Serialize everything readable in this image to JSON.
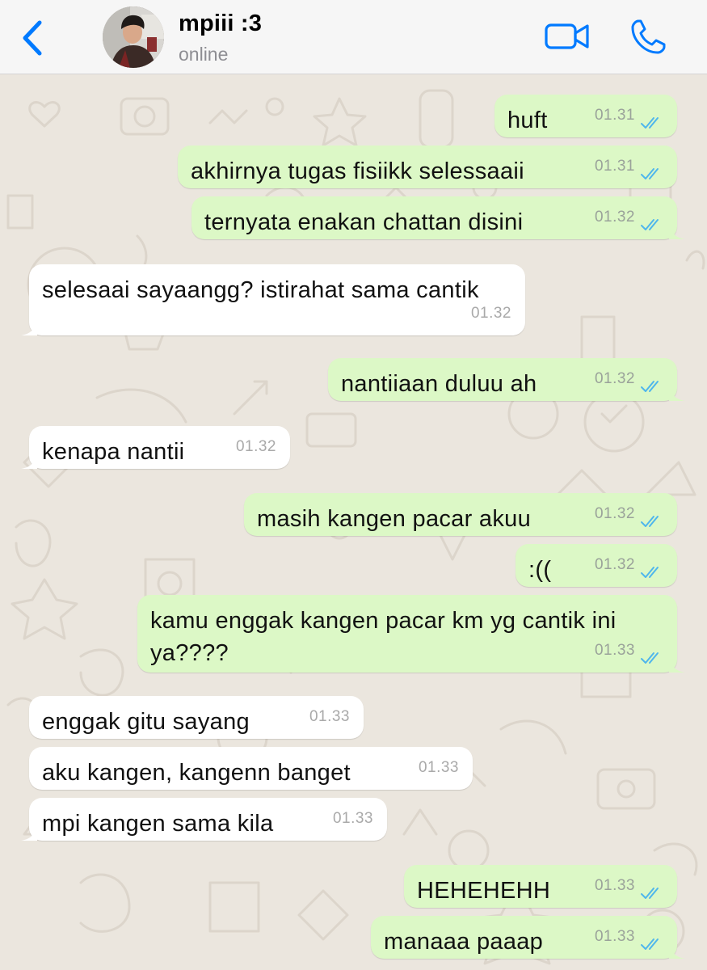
{
  "header": {
    "contact_name": "mpiii :3",
    "status": "online",
    "colors": {
      "accent": "#007aff"
    },
    "icons": [
      "chevron-left-icon",
      "video-camera-icon",
      "phone-icon"
    ]
  },
  "messages": [
    {
      "direction": "out",
      "text": "huft",
      "time": "01.31",
      "read": true
    },
    {
      "direction": "out",
      "text": "akhirnya tugas fisiikk selessaaii",
      "time": "01.31",
      "read": true
    },
    {
      "direction": "out",
      "text": "ternyata enakan chattan disini",
      "time": "01.32",
      "read": true
    },
    {
      "direction": "in",
      "text": "selesaai sayaangg? istirahat sama cantik",
      "time": "01.32"
    },
    {
      "direction": "out",
      "text": "nantiiaan duluu ah",
      "time": "01.32",
      "read": true
    },
    {
      "direction": "in",
      "text": "kenapa nantii",
      "time": "01.32"
    },
    {
      "direction": "out",
      "text": "masih kangen pacar akuu",
      "time": "01.32",
      "read": true
    },
    {
      "direction": "out",
      "text": ":((",
      "time": "01.32",
      "read": true
    },
    {
      "direction": "out",
      "text": "kamu enggak kangen pacar km yg cantik ini ya????",
      "time": "01.33",
      "read": true
    },
    {
      "direction": "in",
      "text": "enggak gitu sayang",
      "time": "01.33"
    },
    {
      "direction": "in",
      "text": "aku kangen, kangenn banget",
      "time": "01.33"
    },
    {
      "direction": "in",
      "text": "mpi kangen sama kila",
      "time": "01.33"
    },
    {
      "direction": "out",
      "text": "HEHEHEHH",
      "time": "01.33",
      "read": true
    },
    {
      "direction": "out",
      "text": "manaaa paaap",
      "time": "01.33",
      "read": true
    }
  ],
  "colors": {
    "outgoing_bubble": "#dcf8c6",
    "incoming_bubble": "#ffffff",
    "wallpaper": "#ebe6de",
    "read_ticks": "#4fb6ec"
  }
}
